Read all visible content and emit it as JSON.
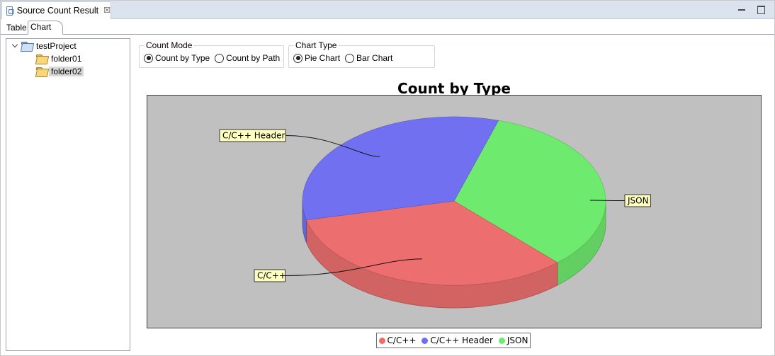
{
  "view": {
    "tab_title": "Source Count Result",
    "close_glyph": "☒",
    "inner_tabs": [
      "Table",
      "Chart"
    ],
    "active_inner_tab": "Chart"
  },
  "tree": {
    "project": "testProject",
    "children": [
      "folder01",
      "folder02"
    ],
    "selected": "folder02"
  },
  "count_mode": {
    "legend": "Count Mode",
    "options": [
      "Count by Type",
      "Count by Path"
    ],
    "selected": "Count by Type"
  },
  "chart_type": {
    "legend": "Chart Type",
    "options": [
      "Pie Chart",
      "Bar Chart"
    ],
    "selected": "Pie Chart"
  },
  "chart_data": {
    "type": "pie",
    "title": "Count by Type",
    "style": "3d",
    "categories": [
      "C/C++",
      "C/C++ Header",
      "JSON"
    ],
    "values": [
      1,
      1,
      1
    ],
    "colors": [
      "#ef6c6c",
      "#6e6ef2",
      "#6cec6c"
    ],
    "legend": [
      "C/C++",
      "C/C++ Header",
      "JSON"
    ],
    "legend_position": "bottom",
    "plot_background": "#c0c0c0"
  }
}
